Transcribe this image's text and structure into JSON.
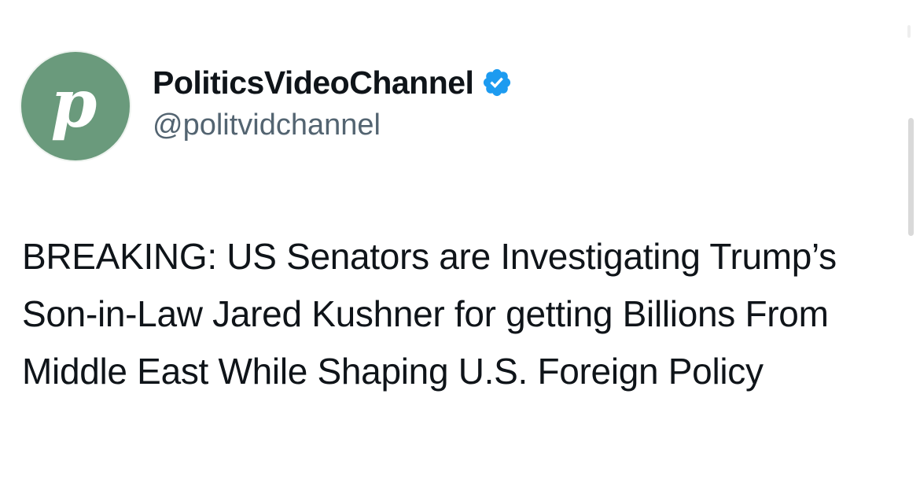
{
  "account": {
    "display_name": "PoliticsVideoChannel",
    "handle": "@politvidchannel",
    "avatar_letter": "p",
    "avatar_color": "#6a9a7c",
    "verified": true,
    "verified_color": "#1d9bf0"
  },
  "tweet": {
    "text": "BREAKING: US Senators are Investigating Trump’s Son-in-Law Jared Kushner for getting Billions From Middle East While Shaping U.S. Foreign Policy"
  },
  "icons": {
    "verified": "verified-badge-icon"
  }
}
